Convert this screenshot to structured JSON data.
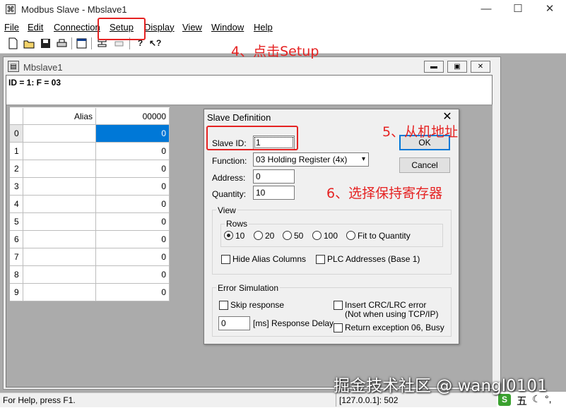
{
  "window": {
    "title": "Modbus Slave - Mbslave1",
    "controls": {
      "minimize": "—",
      "maximize": "☐",
      "close": "✕"
    }
  },
  "menu": [
    {
      "label": "File"
    },
    {
      "label": "Edit"
    },
    {
      "label": "Connection"
    },
    {
      "label": "Setup"
    },
    {
      "label": "Display"
    },
    {
      "label": "View"
    },
    {
      "label": "Window"
    },
    {
      "label": "Help"
    }
  ],
  "toolbar": {
    "icons": [
      "new-icon",
      "open-icon",
      "save-icon",
      "print-icon",
      "window-icon",
      "connect-icon",
      "disconnect-icon",
      "help-icon",
      "context-help-icon"
    ]
  },
  "child": {
    "title": "Mbslave1",
    "id_line": "ID = 1: F = 03",
    "grid": {
      "headers": {
        "alias": "Alias",
        "value": "00000"
      },
      "rows": [
        {
          "index": "0",
          "value": "0"
        },
        {
          "index": "1",
          "value": "0"
        },
        {
          "index": "2",
          "value": "0"
        },
        {
          "index": "3",
          "value": "0"
        },
        {
          "index": "4",
          "value": "0"
        },
        {
          "index": "5",
          "value": "0"
        },
        {
          "index": "6",
          "value": "0"
        },
        {
          "index": "7",
          "value": "0"
        },
        {
          "index": "8",
          "value": "0"
        },
        {
          "index": "9",
          "value": "0"
        }
      ]
    }
  },
  "dialog": {
    "title": "Slave Definition",
    "slave_id_label": "Slave ID:",
    "slave_id_value": "1",
    "function_label": "Function:",
    "function_value": "03 Holding Register (4x)",
    "address_label": "Address:",
    "address_value": "0",
    "quantity_label": "Quantity:",
    "quantity_value": "10",
    "ok_label": "OK",
    "cancel_label": "Cancel",
    "view_group": "View",
    "rows_group": "Rows",
    "rows_options": [
      "10",
      "20",
      "50",
      "100",
      "Fit to Quantity"
    ],
    "rows_selected": "10",
    "hide_alias": "Hide Alias Columns",
    "plc_addresses": "PLC Addresses (Base 1)",
    "error_group": "Error Simulation",
    "skip_response": "Skip response",
    "insert_crc_line1": "Insert CRC/LRC error",
    "insert_crc_line2": "(Not when using TCP/IP)",
    "delay_value": "0",
    "delay_label": "[ms] Response Delay",
    "return_exception": "Return exception 06, Busy"
  },
  "annotations": {
    "setup": "4、点击Setup",
    "slave_id": "5、从机地址",
    "function": "6、选择保持寄存器",
    "color": "#e52222"
  },
  "status": {
    "help": "For Help, press F1.",
    "address": "[127.0.0.1]: 502"
  },
  "watermark": "掘金技术社区 @ wangl0101",
  "ime": {
    "mode": "五"
  }
}
